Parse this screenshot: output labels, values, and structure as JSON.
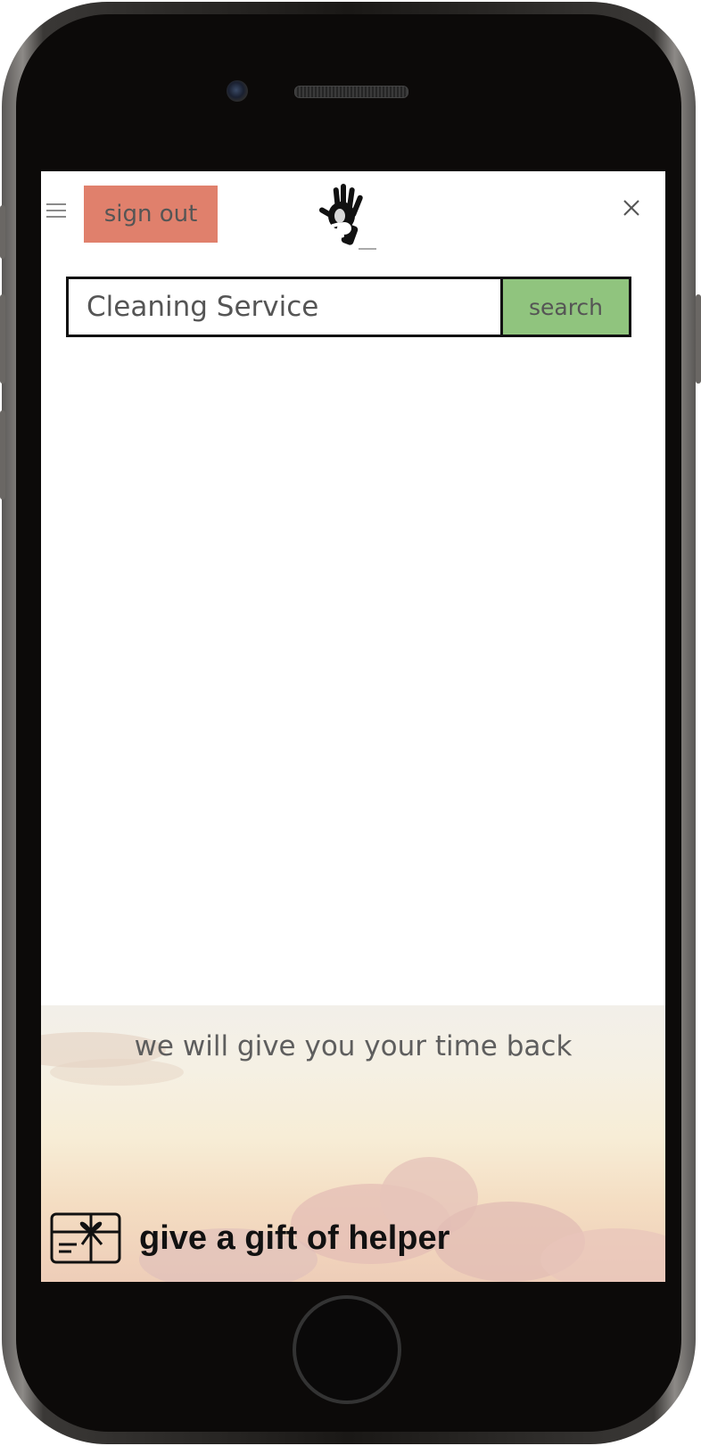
{
  "header": {
    "signout_label": "sign out"
  },
  "search": {
    "value": "Cleaning Service",
    "button_label": "search"
  },
  "banner": {
    "tagline": "we will give you your time back",
    "gift_label": "give a gift of helper"
  },
  "colors": {
    "signout_bg": "#e0806c",
    "search_button_bg": "#90c47e",
    "text_gray": "#555555"
  },
  "icons": [
    "menu-icon",
    "hand-logo-icon",
    "close-icon",
    "gift-card-icon"
  ]
}
